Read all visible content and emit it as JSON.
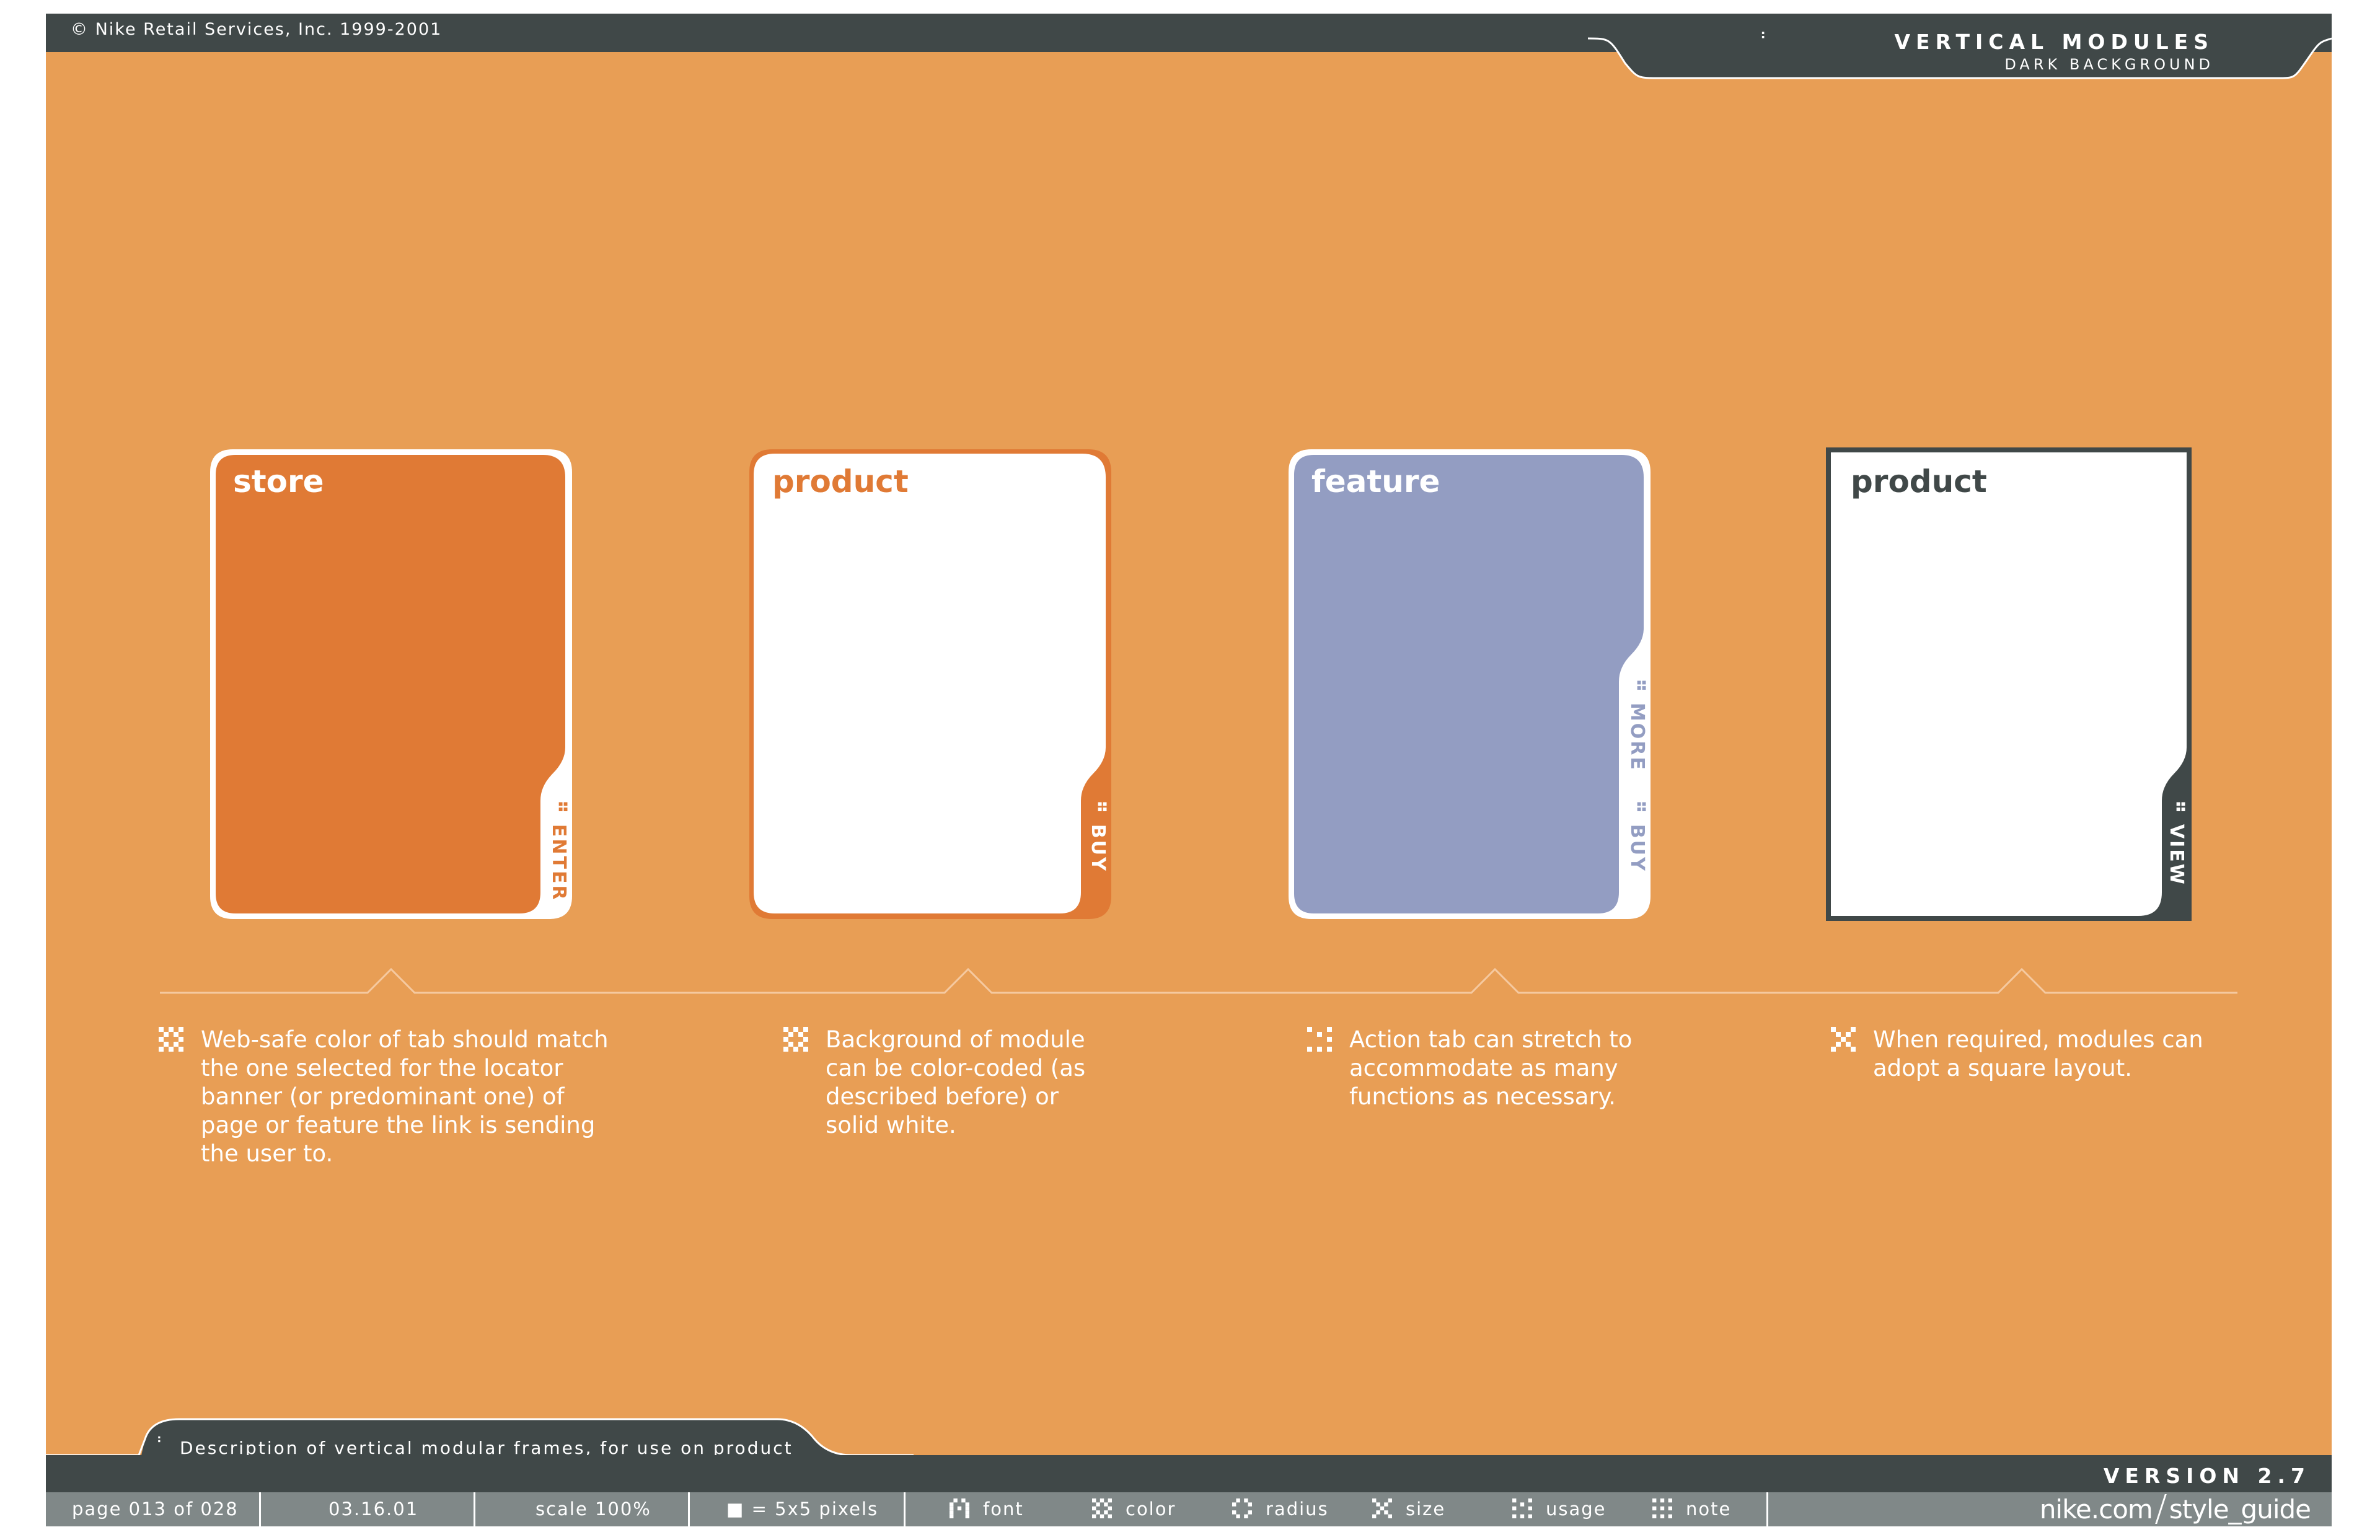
{
  "header": {
    "copyright": "© Nike Retail Services, Inc. 1999-2001",
    "section_title": "VERTICAL MODULES",
    "section_subtitle": "DARK BACKGROUND"
  },
  "modules": [
    {
      "title": "store",
      "tabs": [
        "ENTER"
      ],
      "background": "#E07A35",
      "border": "#ffffff",
      "tab_color": "#ffffff",
      "tab_text_color": "#E07A35"
    },
    {
      "title": "product",
      "tabs": [
        "BUY"
      ],
      "background": "#ffffff",
      "border": "#E07A35",
      "tab_color": "#E07A35",
      "tab_text_color": "#ffffff"
    },
    {
      "title": "feature",
      "tabs": [
        "MORE",
        "BUY"
      ],
      "background": "#939DC2",
      "border": "#ffffff",
      "tab_color": "#ffffff",
      "tab_text_color": "#939DC2"
    },
    {
      "title": "product",
      "tabs": [
        "VIEW"
      ],
      "background": "#ffffff",
      "border": "#404848",
      "tab_color": "#404848",
      "tab_text_color": "#ffffff"
    }
  ],
  "descriptions": [
    {
      "text": "Web-safe color of tab should match the one selected for the locator banner (or predominant one) of page or feature the link is sending the user to.",
      "icon": "color-icon"
    },
    {
      "text": "Background of module can be color-coded (as described before) or solid white.",
      "icon": "color-icon"
    },
    {
      "text": "Action tab can stretch to accommodate as many functions as necessary.",
      "icon": "usage-icon"
    },
    {
      "text": "When required, modules can adopt a square layout.",
      "icon": "radius-icon"
    }
  ],
  "bottom": {
    "description": "Description of vertical modular frames, for use on product highlights, feature banners or info segments",
    "version": "VERSION 2.7"
  },
  "footer": {
    "page": "page 013 of 028",
    "date": "03.16.01",
    "scale": "scale 100%",
    "pixel_unit": "■ = 5x5 pixels",
    "legend": [
      {
        "label": "font",
        "icon": "font-icon"
      },
      {
        "label": "color",
        "icon": "color-icon"
      },
      {
        "label": "radius",
        "icon": "radius-icon"
      },
      {
        "label": "size",
        "icon": "size-icon"
      },
      {
        "label": "usage",
        "icon": "usage-icon"
      },
      {
        "label": "note",
        "icon": "note-icon"
      }
    ],
    "brand": "nike.com",
    "brand_section": "style_guide"
  },
  "colors": {
    "page_background": "#E89E55",
    "dark_bar": "#404848",
    "footer_bar": "#808888",
    "orange": "#E07A35",
    "periwinkle": "#939DC2",
    "white": "#ffffff"
  }
}
